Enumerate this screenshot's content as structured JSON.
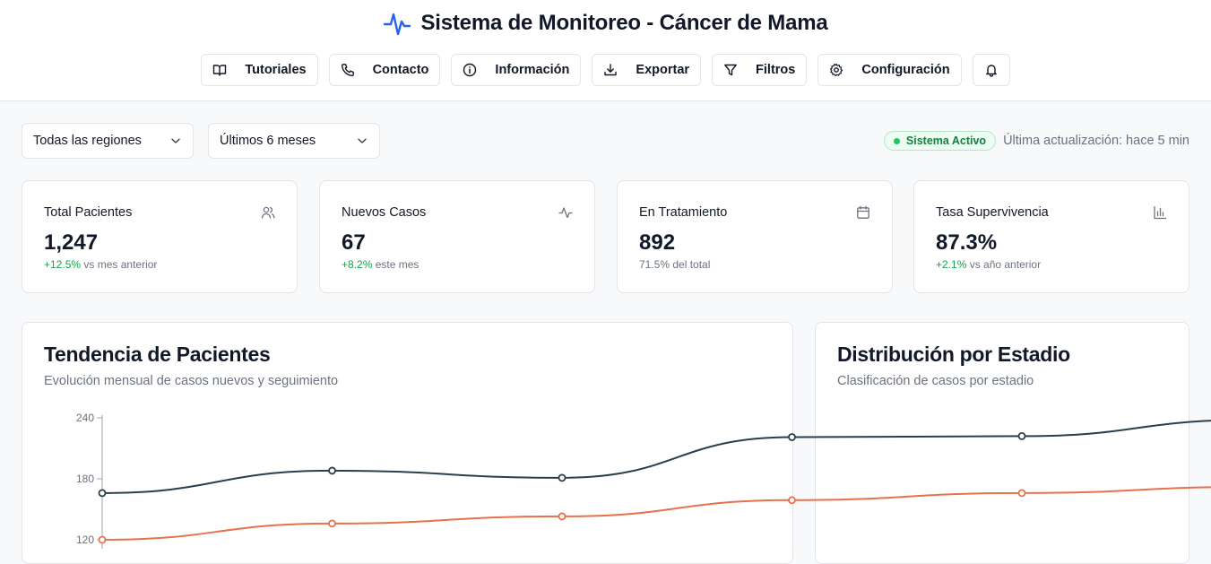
{
  "header": {
    "title": "Sistema de Monitoreo - Cáncer de Mama",
    "nav": [
      {
        "label": "Tutoriales",
        "icon": "book-open-icon"
      },
      {
        "label": "Contacto",
        "icon": "phone-icon"
      },
      {
        "label": "Información",
        "icon": "info-icon"
      },
      {
        "label": "Exportar",
        "icon": "download-icon"
      },
      {
        "label": "Filtros",
        "icon": "filter-icon"
      },
      {
        "label": "Configuración",
        "icon": "settings-icon"
      }
    ],
    "notifications_icon": "bell-icon"
  },
  "filters": {
    "region": "Todas las regiones",
    "period": "Últimos 6 meses"
  },
  "status": {
    "badge": "Sistema Activo",
    "updated": "Última actualización: hace 5 min",
    "color": "#22c55e"
  },
  "cards": [
    {
      "title": "Total Pacientes",
      "value": "1,247",
      "change": "+12.5%",
      "note": " vs mes anterior",
      "icon": "users-icon"
    },
    {
      "title": "Nuevos Casos",
      "value": "67",
      "change": "+8.2%",
      "note": " este mes",
      "icon": "activity-icon"
    },
    {
      "title": "En Tratamiento",
      "value": "892",
      "change": "",
      "note": "71.5% del total",
      "icon": "calendar-icon"
    },
    {
      "title": "Tasa Supervivencia",
      "value": "87.3%",
      "change": "+2.1%",
      "note": " vs año anterior",
      "icon": "bar-chart-icon"
    }
  ],
  "trend_panel": {
    "title": "Tendencia de Pacientes",
    "subtitle": "Evolución mensual de casos nuevos y seguimiento"
  },
  "stage_panel": {
    "title": "Distribución por Estadio",
    "subtitle": "Clasificación de casos por estadio"
  },
  "chart_data": {
    "type": "line",
    "x": [
      0,
      1,
      2,
      3,
      4,
      5
    ],
    "y_ticks": [
      "240",
      "180",
      "120"
    ],
    "series": [
      {
        "values": [
          166,
          188,
          181,
          221,
          222,
          238
        ],
        "color": "#2b3f4a"
      },
      {
        "values": [
          120,
          136,
          143,
          159,
          166,
          172
        ],
        "color": "#e8704e"
      }
    ],
    "ylim": [
      120,
      240
    ],
    "grid": false
  }
}
